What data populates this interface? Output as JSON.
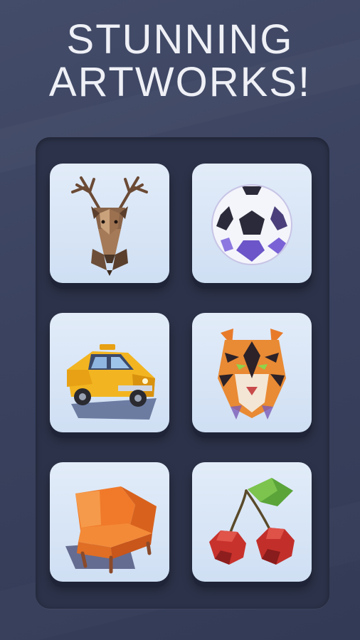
{
  "header": {
    "title_line1": "STUNNING",
    "title_line2": "ARTWORKS!"
  },
  "gallery": {
    "artworks": [
      {
        "name": "deer",
        "icon": "deer-icon"
      },
      {
        "name": "soccer ball",
        "icon": "soccer-ball-icon"
      },
      {
        "name": "taxi car",
        "icon": "taxi-icon"
      },
      {
        "name": "tiger",
        "icon": "tiger-icon"
      },
      {
        "name": "armchair",
        "icon": "armchair-icon"
      },
      {
        "name": "cherries",
        "icon": "cherries-icon"
      }
    ]
  },
  "colors": {
    "background": "#3a4260",
    "panel": "#2c3249",
    "tile": "#d8e5f6",
    "title_text": "#eef0f6"
  }
}
